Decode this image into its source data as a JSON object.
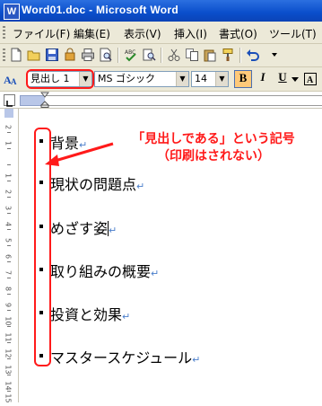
{
  "window": {
    "title": "Word01.doc - Microsoft Word",
    "app_icon": "W"
  },
  "menu": {
    "items": [
      "ファイル(F)",
      "編集(E)",
      "表示(V)",
      "挿入(I)",
      "書式(O)",
      "ツール(T)"
    ]
  },
  "format_toolbar": {
    "style": "見出し 1",
    "font": "MS ゴシック",
    "size": "14",
    "bold": "B",
    "italic": "I",
    "underline": "U"
  },
  "document": {
    "paragraphs": [
      "背景",
      "現状の問題点",
      "めざす姿",
      "取り組みの概要",
      "投資と効果",
      "マスタースケジュール"
    ],
    "paragraph_mark": "↵"
  },
  "ruler": {
    "numbers": [
      "2",
      "1",
      "1",
      "2",
      "3",
      "4",
      "5",
      "6",
      "7",
      "8",
      "9",
      "10",
      "11",
      "12",
      "13",
      "14",
      "15"
    ]
  },
  "annotation": {
    "line1": "「見出しである」という記号",
    "line2": "（印刷はされない）",
    "color": "#ff1a1a"
  }
}
